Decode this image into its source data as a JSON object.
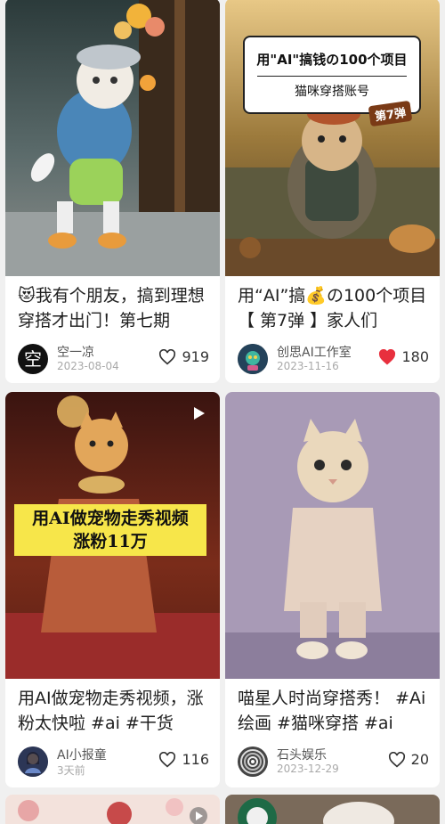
{
  "cards": [
    {
      "title": "😻我有个朋友，搞到理想穿搭才出门！第七期",
      "author": "空一凉",
      "avatar_text": "空",
      "date": "2023-08-04",
      "likes": "919",
      "liked": false
    },
    {
      "title": "用“AI”搞💰の100个项目【 第7弹 】家人们",
      "author": "创思AI工作室",
      "date": "2023-11-16",
      "likes": "180",
      "liked": true,
      "banner_line1": "用\"AI\"搞钱の100个项目",
      "banner_line2": "猫咪穿搭账号",
      "tag": "第7弹"
    },
    {
      "title": "用AI做宠物走秀视频，涨粉太快啦 #ai #干货",
      "author": "AI小报童",
      "date": "3天前",
      "likes": "116",
      "liked": false,
      "banner_line1": "用AI做宠物走秀视频",
      "banner_line2": "涨粉11万"
    },
    {
      "title": "喵星人时尚穿搭秀！ #Ai绘画 #猫咪穿搭 #ai",
      "author": "石头娱乐",
      "date": "2023-12-29",
      "likes": "20",
      "liked": false
    }
  ],
  "colors": {
    "liked_heart": "#e8303e",
    "background": "#f0f0f0"
  }
}
